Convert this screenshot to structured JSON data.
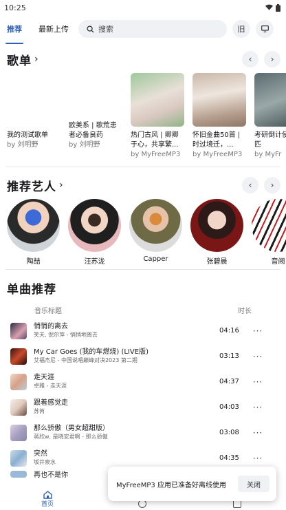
{
  "status": {
    "time": "10:25"
  },
  "topbar": {
    "tabs": [
      {
        "label": "推荐",
        "active": true
      },
      {
        "label": "最新上传",
        "active": false
      }
    ],
    "search_placeholder": "搜索",
    "btn_old": "旧"
  },
  "playlists": {
    "title": "歌单",
    "items": [
      {
        "title": "我的测试歌单",
        "by": "by 刘明野"
      },
      {
        "title": "欧美系 | 歌荒患者必备良药",
        "by": "by 刘明野"
      },
      {
        "title": "热门古风 | 卿卿于心，共享繁...",
        "by": "by MyFreeMP3"
      },
      {
        "title": "怀旧金曲50首 | 时过境迁，...",
        "by": "by MyFreeMP3"
      },
      {
        "title": "考研倒计使单枪匹",
        "by": "by MyFr"
      }
    ]
  },
  "artists": {
    "title": "推荐艺人",
    "items": [
      {
        "name": "陶喆"
      },
      {
        "name": "汪苏泷"
      },
      {
        "name": "Capper"
      },
      {
        "name": "张碧晨"
      },
      {
        "name": "音阙"
      }
    ]
  },
  "songs": {
    "title": "单曲推荐",
    "header_title": "音乐标题",
    "header_time": "时长",
    "more": "···",
    "items": [
      {
        "name": "悄悄的离去",
        "artist": "笑天, 倪尔萍 - 悄悄地离去",
        "time": "04:16"
      },
      {
        "name": "My Car Goes (我的车燃烧) (LIVE版)",
        "artist": "艾福杰尼 - 中国说唱巅峰对决2023 第二期",
        "time": "03:13"
      },
      {
        "name": "走天涯",
        "artist": "卓雅 - 走天涯",
        "time": "04:37"
      },
      {
        "name": "跟着感觉走",
        "artist": "苏芮",
        "time": "04:03"
      },
      {
        "name": "那么骄傲（男女超甜版）",
        "artist": "蒋欣w, 是晓安君啊 - 那么骄傲",
        "time": "03:08"
      },
      {
        "name": "突然",
        "artist": "坂井泉水",
        "time": "04:35"
      },
      {
        "name": "再也不是你",
        "artist": "",
        "time": ""
      }
    ]
  },
  "toast": {
    "message": "MyFreeMP3 应用已准备好离线使用",
    "button": "关闭"
  },
  "bottomnav": {
    "home": "首页"
  },
  "colors": {
    "accent": "#2f5fb4",
    "chip_bg": "#eff1f5"
  }
}
